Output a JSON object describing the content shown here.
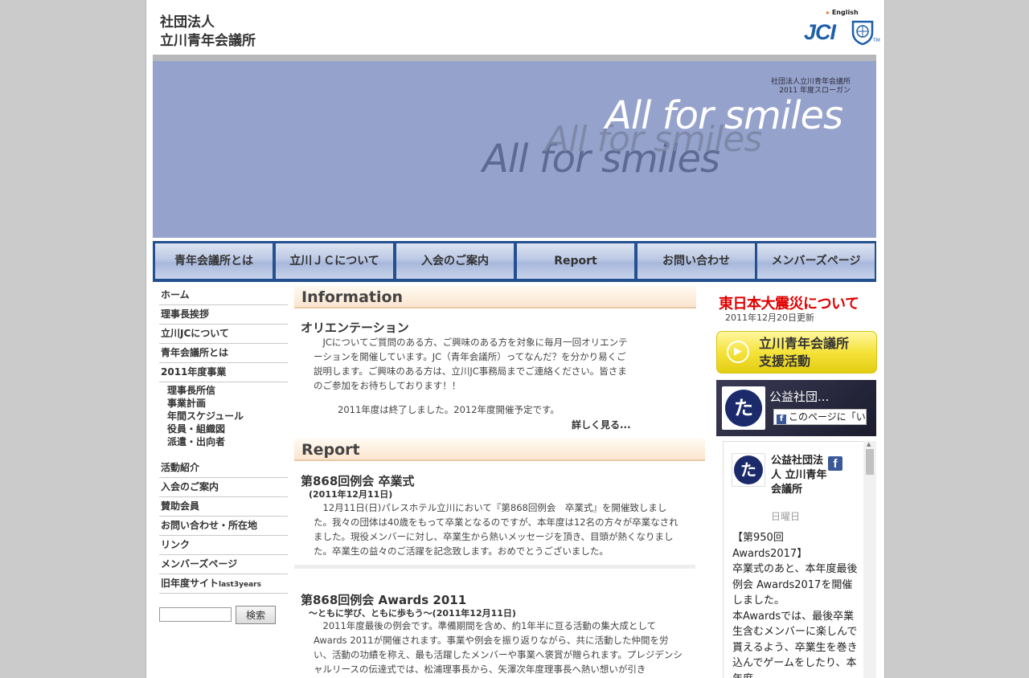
{
  "header": {
    "org_line1": "社団法人",
    "org_line2": "立川青年会議所",
    "english_link": "English",
    "logo_text": "JCI"
  },
  "banner": {
    "org_caption": "社団法人立川青年会議所",
    "year_caption": "2011 年度スローガン",
    "slogan": "All for smiles"
  },
  "nav": {
    "items": [
      "青年会議所とは",
      "立川ＪＣについて",
      "入会のご案内",
      "Report",
      "お問い合わせ",
      "メンバーズページ"
    ]
  },
  "sidebar": {
    "top_items": [
      "ホーム",
      "理事長挨拶",
      "立川JCについて",
      "青年会議所とは",
      "2011年度事業"
    ],
    "sub_items": [
      "理事長所信",
      "事業計画",
      "年間スケジュール",
      "役員・組織図",
      "派遣・出向者"
    ],
    "bottom_items": [
      "活動紹介",
      "入会のご案内",
      "賛助会員",
      "お問い合わせ・所在地",
      "リンク",
      "メンバーズページ"
    ],
    "old_site_label": "旧年度サイト",
    "old_site_suffix": "last3years",
    "search_button": "検索"
  },
  "information": {
    "heading": "Information",
    "title": "オリエンテーション",
    "body": "JCについてご質問のある方、ご興味のある方を対象に毎月一回オリエンテーションを開催しています。JC（青年会議所）ってなんだ？を分かり易くご説明します。ご興味のある方は、立川JC事務局までご連絡ください。皆さまのご参加をお待ちしております！！",
    "note": "2011年度は終了しました。2012年度開催予定です。",
    "more": "詳しく見る..."
  },
  "report": {
    "heading": "Report",
    "article1": {
      "title": "第868回例会 卒業式",
      "date": "(2011年12月11日)",
      "body": "12月11日(日)パレスホテル立川において『第868回例会　卒業式』を開催致しました。我々の団体は40歳をもって卒業となるのですが、本年度は12名の方々が卒業なされました。現役メンバーに対し、卒業生から熱いメッセージを頂き、目頭が熱くなりました。卒業生の益々のご活躍を記念致します。おめでとうございました。"
    },
    "article2": {
      "title": "第868回例会 Awards 2011",
      "date": "～ともに学び、ともに歩もう～(2011年12月11日)",
      "body": "2011年度最後の例会です。準備期間を含め、約1年半に亘る活動の集大成としてAwards 2011が開催されます。事業や例会を振り返りながら、共に活動した仲間を労い、活動の功績を称え、最も活躍したメンバーや事業へ褒賞が贈られます。プレジデンシャルリースの伝達式では、松浦理事長から、矢澤次年度理事長へ熱い想いが引き"
    }
  },
  "right": {
    "quake_title": "東日本大震災について",
    "quake_date": "2011年12月20日更新",
    "support_label": "立川青年会議所\n支援活動",
    "fb_header_title": "公益社団...",
    "fb_like": "このページに「い",
    "fb_logo_char": "た",
    "fb_f": "f",
    "fb_page_name": "公益社団法人 立川青年会議所",
    "fb_day": "日曜日",
    "fb_post": "【第950回 Awards2017】\n卒業式のあと、本年度最後例会 Awards2017を開催しました。\n本Awardsでは、最後卒業生含むメンバーに楽しんで貰えるよう、卒業生を巻き込んでゲームをしたり、本年度"
  },
  "colors": {
    "banner": "#95a2cb",
    "nav_bar": "#24508f",
    "quake_red": "#e00000",
    "support_yellow": "#f5e33a",
    "jci_blue": "#1f5ea8"
  }
}
